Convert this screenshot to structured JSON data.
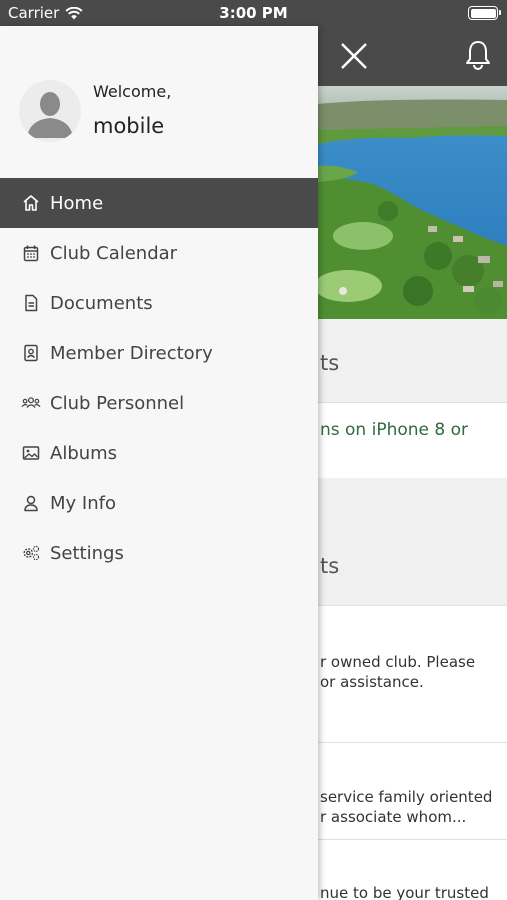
{
  "status_bar": {
    "carrier": "Carrier",
    "time": "3:00 PM"
  },
  "drawer": {
    "welcome": "Welcome,",
    "username": "mobile",
    "items": [
      {
        "label": "Home",
        "icon": "home-icon",
        "active": true
      },
      {
        "label": "Club Calendar",
        "icon": "calendar-icon"
      },
      {
        "label": "Documents",
        "icon": "document-icon"
      },
      {
        "label": "Member Directory",
        "icon": "contact-book-icon"
      },
      {
        "label": "Club Personnel",
        "icon": "group-icon"
      },
      {
        "label": "Albums",
        "icon": "image-icon"
      },
      {
        "label": "My Info",
        "icon": "person-icon"
      },
      {
        "label": "Settings",
        "icon": "gears-icon"
      }
    ]
  },
  "background": {
    "section1_title_fragment": "ts",
    "notice_fragment": "ns on iPhone 8 or",
    "section2_title_fragment": "ts",
    "item1_line1": "r owned club.   Please",
    "item1_line2": "or assistance.",
    "item2_line1": " service family oriented",
    "item2_line2": "r associate whom...",
    "item3_line1": "nue to be your trusted"
  },
  "colors": {
    "header": "#4a4a4a",
    "drawer_bg": "#f7f7f7",
    "active_item": "#4a4a4a",
    "link_green": "#2e6b3d"
  }
}
